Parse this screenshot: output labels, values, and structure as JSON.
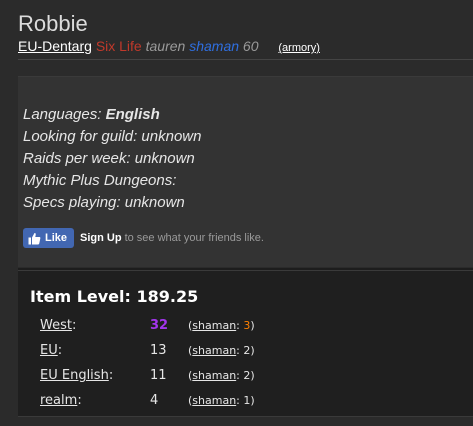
{
  "character": {
    "name": "Robbie",
    "realm": "EU-Dentarg",
    "guild": "Six Life",
    "race": "tauren",
    "class": "shaman",
    "level": "60",
    "armory_link": "(armory)"
  },
  "info": {
    "languages_label": "Languages: ",
    "languages_value": "English",
    "looking_for_guild": "Looking for guild: unknown",
    "raids_per_week": "Raids per week: unknown",
    "mythic_plus": "Mythic Plus Dungeons:",
    "specs_playing": "Specs playing: unknown"
  },
  "facebook": {
    "like_label": "Like",
    "signup_label": "Sign Up",
    "signup_text": "to see what your friends like."
  },
  "item_level": {
    "title": "Item Level: 189.25",
    "rows": [
      {
        "label": "West",
        "suffix": ":",
        "rank": "32",
        "spec": "shaman",
        "spec_rank": "3"
      },
      {
        "label": "EU",
        "suffix": ":",
        "rank": "13",
        "spec": "shaman",
        "spec_rank": "2"
      },
      {
        "label": "EU English",
        "suffix": ":",
        "rank": "11",
        "spec": "shaman",
        "spec_rank": "2"
      },
      {
        "label": "realm",
        "suffix": ":",
        "rank": "4",
        "spec": "shaman",
        "spec_rank": "1"
      }
    ]
  },
  "colors": {
    "guild": "#c0392b",
    "class": "#2f6fe0",
    "top_rank": "#a335ee",
    "top_spec_rank": "#ff8000",
    "facebook_blue": "#4267b2"
  },
  "icons": {
    "facebook_thumb": "thumbs-up-icon"
  }
}
